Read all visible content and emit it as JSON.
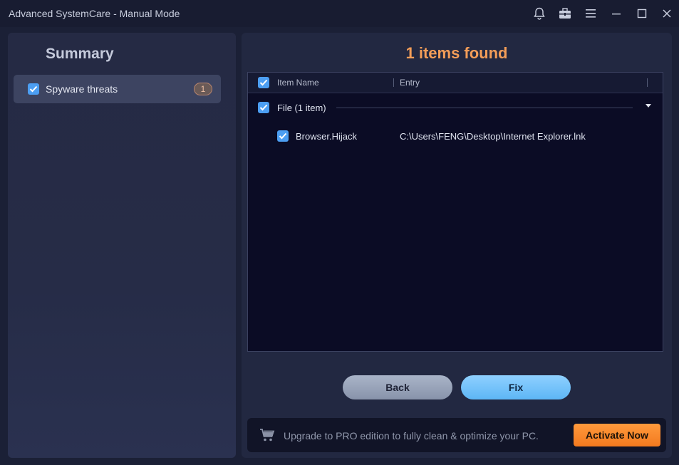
{
  "window": {
    "title": "Advanced SystemCare - Manual Mode",
    "controls": [
      "bell-icon",
      "toolbox-icon",
      "menu-icon",
      "minimize-icon",
      "maximize-icon",
      "close-icon"
    ]
  },
  "sidebar": {
    "title": "Summary",
    "items": [
      {
        "label": "Spyware threats",
        "count": "1",
        "checked": true
      }
    ]
  },
  "main": {
    "headline": "1 items found",
    "table": {
      "columns": [
        "Item Name",
        "Entry"
      ],
      "groups": [
        {
          "label": "File (1 item)",
          "checked": true,
          "rows": [
            {
              "name": "Browser.Hijack",
              "entry": "C:\\Users\\FENG\\Desktop\\Internet Explorer.lnk",
              "checked": true
            }
          ]
        }
      ]
    },
    "buttons": {
      "back": "Back",
      "fix": "Fix"
    },
    "promo": {
      "text": "Upgrade to PRO edition to fully clean & optimize your PC.",
      "action": "Activate Now"
    }
  },
  "colors": {
    "accent": "#f39d58",
    "checkbox": "#4c9ef2",
    "fix_button": "#70c0f8",
    "activate_button": "#f78a2c"
  }
}
